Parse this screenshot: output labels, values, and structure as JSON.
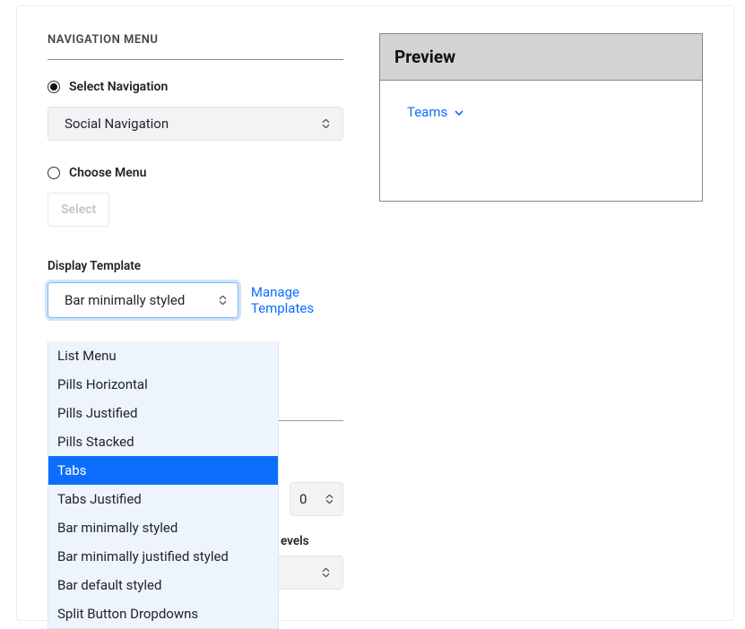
{
  "section_title": "NAVIGATION MENU",
  "radio": {
    "select_nav": "Select Navigation",
    "choose_menu": "Choose Menu"
  },
  "nav_select_value": "Social Navigation",
  "select_button": "Select",
  "display_template_label": "Display Template",
  "template_select_value": "Bar minimally styled",
  "manage_templates": "Manage Templates",
  "dropdown_items": [
    "List Menu",
    "Pills Horizontal",
    "Pills Justified",
    "Pills Stacked",
    "Tabs",
    "Tabs Justified",
    "Bar minimally styled",
    "Bar minimally justified styled",
    "Bar default styled",
    "Split Button Dropdowns"
  ],
  "dropdown_highlight_index": 4,
  "preview_title": "Preview",
  "preview_link": "Teams",
  "levels_label": "evels",
  "num_value": "0"
}
